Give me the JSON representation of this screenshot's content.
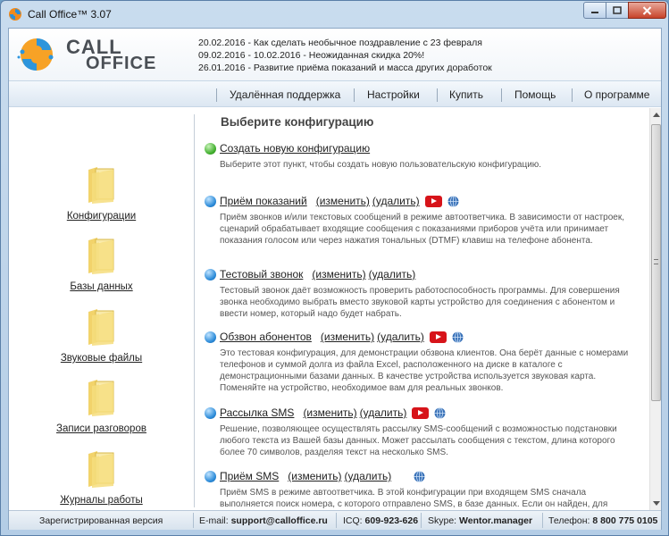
{
  "window": {
    "title": "Call Office™ 3.07"
  },
  "logo": {
    "line1": "CALL",
    "line2": "OFFICE"
  },
  "news": [
    "20.02.2016 - Как сделать необычное поздравление с 23 февраля",
    "09.02.2016 - 10.02.2016 - Неожиданная скидка 20%!",
    "26.01.2016 - Развитие приёма показаний и масса других доработок"
  ],
  "nav": {
    "remote": "Удалённая поддержка",
    "settings": "Настройки",
    "buy": "Купить",
    "help": "Помощь",
    "about": "О программе"
  },
  "sidebar": {
    "items": [
      {
        "label": "Конфигурации"
      },
      {
        "label": "Базы данных"
      },
      {
        "label": "Звуковые файлы"
      },
      {
        "label": "Записи разговоров"
      },
      {
        "label": "Журналы работы"
      }
    ]
  },
  "main": {
    "title": "Выберите конфигурацию",
    "create": {
      "label": "Создать новую конфигурацию",
      "desc": "Выберите этот пункт, чтобы создать новую пользовательскую конфигурацию."
    },
    "actions": {
      "edit": "(изменить)",
      "delete": "(удалить)"
    },
    "configs": [
      {
        "name": "Приём показаний",
        "desc": "Приём звонков и/или текстовых сообщений в режиме автоответчика. В зависимости от настроек, сценарий обрабатывает входящие сообщения с показаниями приборов учёта или принимает показания голосом или через нажатия тональных (DTMF) клавиш на телефоне абонента."
      },
      {
        "name": "Тестовый звонок",
        "desc": "Тестовый звонок даёт возможность проверить работоспособность программы. Для совершения звонка необходимо выбрать вместо звуковой карты устройство для соединения с абонентом и ввести номер, который надо будет набрать."
      },
      {
        "name": "Обзвон абонентов",
        "desc": "Это тестовая конфигурация, для демонстрации обзвона клиентов. Она берёт данные с номерами телефонов и суммой долга из файла Excel, расположенного на диске в каталоге с демонстрационными базами данных. В качестве устройства используется звуковая карта. Поменяйте на устройство, необходимое вам для реальных звонков."
      },
      {
        "name": "Рассылка SMS",
        "desc": "Решение, позволяющее осуществлять рассылку SMS-сообщений с возможностью подстановки любого текста из Вашей базы данных. Может рассылать сообщения с текстом, длина которого более 70 символов, разделяя текст на несколько SMS."
      },
      {
        "name": "Приём SMS",
        "desc": "Приём SMS в режиме автоответчика. В этой конфигурации при входящем SMS сначала выполняется поиск номера, с которого отправлено SMS, в базе данных. Если он найден, для"
      }
    ]
  },
  "status": {
    "registered": "Зарегистрированная версия",
    "email_label": "E-mail:",
    "email": "support@calloffice.ru",
    "icq_label": "ICQ:",
    "icq": "609-923-626",
    "skype_label": "Skype:",
    "skype": "Wentor.manager",
    "phone_label": "Телефон:",
    "phone": "8 800 775 0105"
  },
  "colors": {
    "youtube": "#d7141a",
    "bullet_blue": "#2a8ad8",
    "bullet_green": "#3fae2c"
  }
}
